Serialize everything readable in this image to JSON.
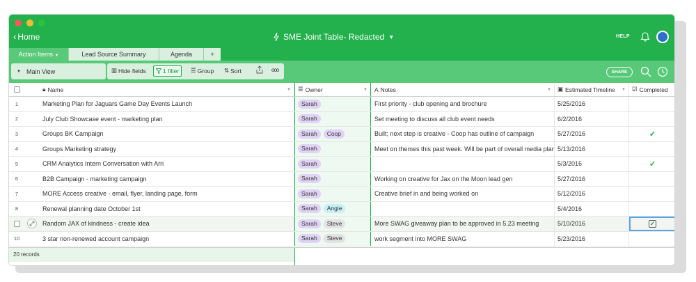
{
  "nav": {
    "home_label": "Home",
    "title": "SME Joint Table- Redacted",
    "help_label": "HELP"
  },
  "tabs": [
    {
      "label": "Action Items"
    },
    {
      "label": "Lead Source Summary"
    },
    {
      "label": "Agenda"
    },
    {
      "label": "+"
    }
  ],
  "toolbar": {
    "view_label": "Main View",
    "hide_fields": "Hide fields",
    "filter": "1 filter",
    "group": "Group",
    "sort": "Sort",
    "share": "SHARE"
  },
  "columns": {
    "name": "Name",
    "owner": "Owner",
    "notes": "Notes",
    "date": "Estimated Timeline",
    "completed": "Completed"
  },
  "rows": [
    {
      "num": "1",
      "name": "Marketing Plan for Jaguars Game Day Events Launch",
      "owners": [
        "Sarah"
      ],
      "notes": "First priority - club opening and brochure",
      "date": "5/25/2016",
      "completed": false
    },
    {
      "num": "2",
      "name": "July Club Showcase event - marketing plan",
      "owners": [
        "Sarah"
      ],
      "notes": "Set meeting to discuss all club event needs",
      "date": "6/2/2016",
      "completed": false
    },
    {
      "num": "3",
      "name": "Groups BK Campaign",
      "owners": [
        "Sarah",
        "Coop"
      ],
      "notes": "Built; next step is creative - Coop has outline of campaign",
      "date": "5/27/2016",
      "completed": true
    },
    {
      "num": "4",
      "name": "Groups Marketing strategy",
      "owners": [
        "Sarah"
      ],
      "notes": "Meet on themes this past week. Will be part of overall media plan",
      "date": "5/13/2016",
      "completed": false
    },
    {
      "num": "5",
      "name": "CRM Analytics Intern Conversation with Arri",
      "owners": [
        "Sarah"
      ],
      "notes": "",
      "date": "5/3/2016",
      "completed": true
    },
    {
      "num": "6",
      "name": "B2B Campaign - marketing campaign",
      "owners": [
        "Sarah"
      ],
      "notes": "Working on creative for Jax on the Moon lead gen",
      "date": "5/27/2016",
      "completed": false
    },
    {
      "num": "7",
      "name": "MORE Access creative - email, flyer, landing page, form",
      "owners": [
        "Sarah"
      ],
      "notes": "Creative brief in and being worked on",
      "date": "5/12/2016",
      "completed": false
    },
    {
      "num": "8",
      "name": "Renewal planning date October 1st",
      "owners": [
        "Sarah",
        "Angie"
      ],
      "notes": "",
      "date": "5/4/2016",
      "completed": false
    },
    {
      "num": "",
      "name": "Random JAX of kindness - create idea",
      "owners": [
        "Sarah",
        "Steve"
      ],
      "notes": "More SWAG giveaway plan to be approved in 5.23 meeting",
      "date": "5/10/2016",
      "completed": true
    },
    {
      "num": "10",
      "name": "3 star non-renewed account campaign",
      "owners": [
        "Sarah",
        "Steve"
      ],
      "notes": "work segment into MORE SWAG",
      "date": "5/23/2016",
      "completed": false
    }
  ],
  "footer": {
    "records": "20 records"
  },
  "colors": {
    "accent": "#22b14c",
    "toolbar": "#58c978",
    "chip_sarah": "#e0d3f5",
    "chip_coop": "#e0d3f5",
    "chip_angie": "#c8f1f7",
    "chip_steve": "#e3e3e3"
  }
}
